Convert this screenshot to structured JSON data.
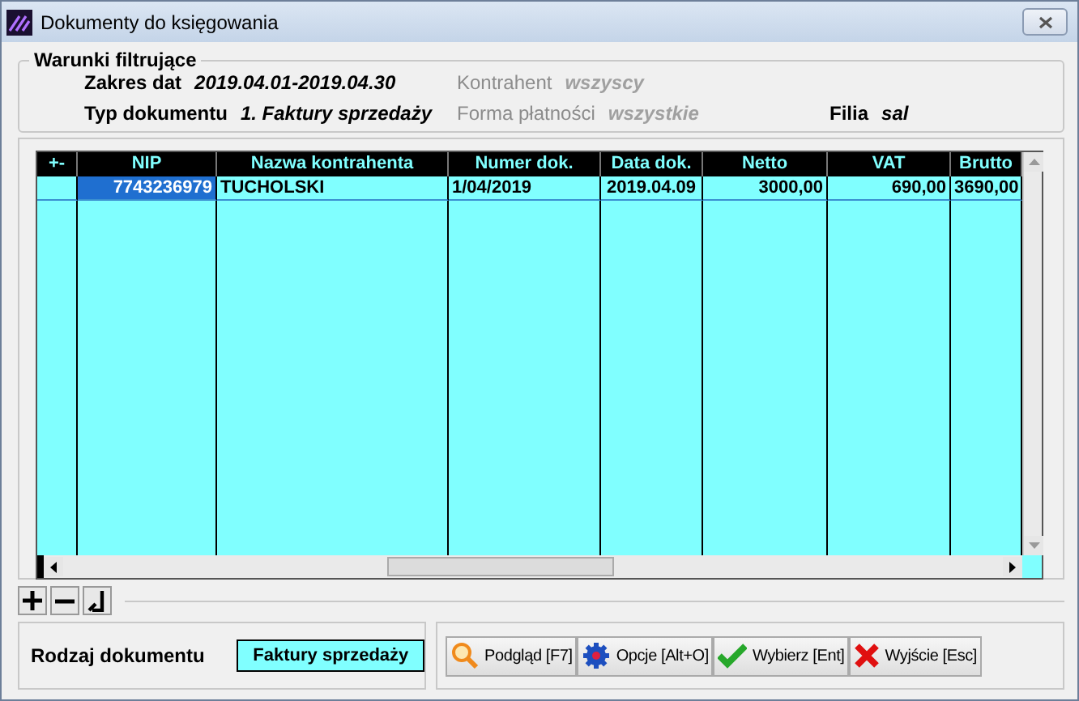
{
  "window": {
    "title": "Dokumenty do księgowania"
  },
  "filter": {
    "title": "Warunki filtrujące",
    "fields": [
      {
        "label": "Zakres dat",
        "value": "2019.04.01-2019.04.30",
        "disabled": false
      },
      {
        "label": "Kontrahent",
        "value": "wszyscy",
        "disabled": true
      },
      {
        "label": "Typ dokumentu",
        "value": "1. Faktury sprzedaży",
        "disabled": false
      },
      {
        "label": "Forma płatności",
        "value": "wszystkie",
        "disabled": true
      },
      {
        "label": "Filia",
        "value": "sal",
        "disabled": false
      }
    ]
  },
  "table": {
    "columns": [
      {
        "label": "+-"
      },
      {
        "label": "NIP"
      },
      {
        "label": "Nazwa kontrahenta"
      },
      {
        "label": "Numer dok."
      },
      {
        "label": "Data dok."
      },
      {
        "label": "Netto"
      },
      {
        "label": "VAT"
      },
      {
        "label": "Brutto"
      }
    ],
    "rows": [
      {
        "selected": true,
        "cells": [
          "",
          "7743236979",
          "TUCHOLSKI",
          "1/04/2019",
          "2019.04.09",
          "3000,00",
          "690,00",
          "3690,00"
        ]
      }
    ]
  },
  "document_type": {
    "label": "Rodzaj dokumentu",
    "value": "Faktury sprzedaży"
  },
  "buttons": [
    {
      "kind": "preview",
      "label": "Podgląd",
      "shortcut": "[F7]"
    },
    {
      "kind": "options",
      "label": "Opcje",
      "shortcut": "[Alt+O]"
    },
    {
      "kind": "select",
      "label": "Wybierz",
      "shortcut": "[Ent]"
    },
    {
      "kind": "exit",
      "label": "Wyjście",
      "shortcut": "[Esc]"
    }
  ]
}
